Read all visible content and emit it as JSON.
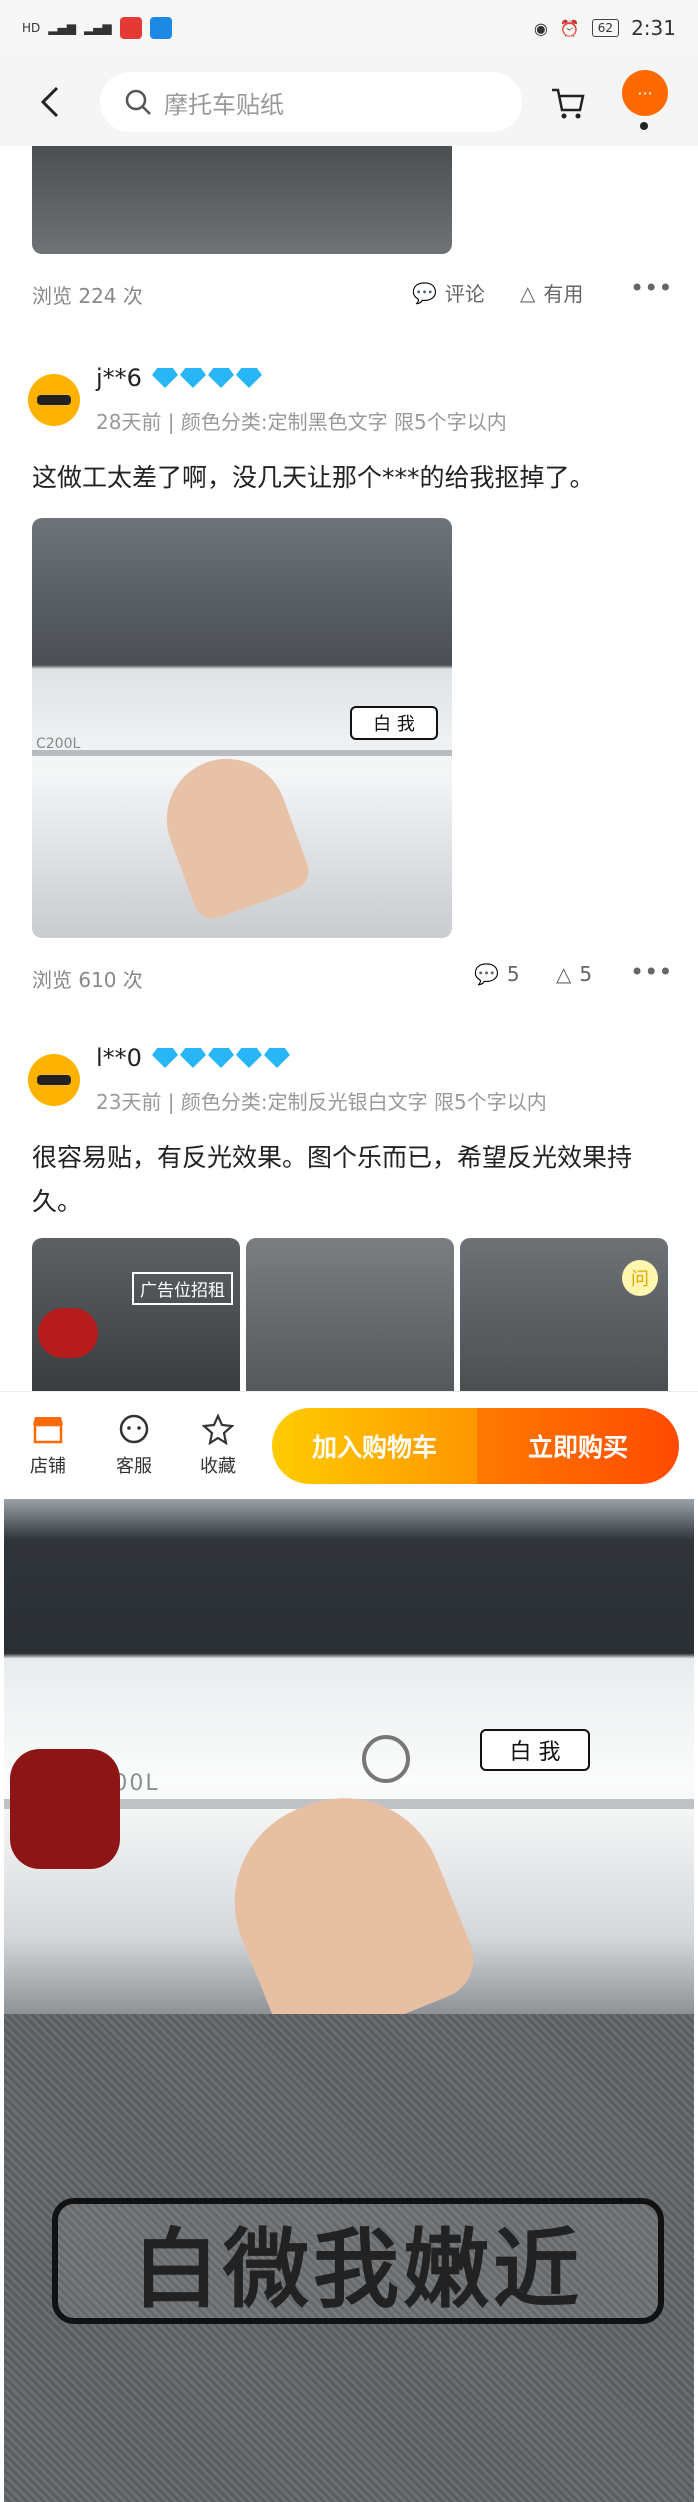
{
  "status": {
    "network_left": "HD",
    "battery": "62",
    "time": "2:31"
  },
  "nav": {
    "search_placeholder": "摩托车贴纸",
    "more_label": "···"
  },
  "first_post": {
    "views": "浏览 224 次",
    "comment_label": "评论",
    "useful_label": "有用"
  },
  "reviews": [
    {
      "user": "j**6",
      "diamonds": 4,
      "meta": "28天前 | 颜色分类:定制黑色文字 限5个字以内",
      "text": "这做工太差了啊，没几天让那个***的给我抠掉了。",
      "views": "浏览 610 次",
      "comments": "5",
      "likes": "5",
      "plate_text": "白 我",
      "car_badge": "C200L"
    },
    {
      "user": "l**0",
      "diamonds": 5,
      "meta": "23天前 | 颜色分类:定制反光银白文字 限5个字以内",
      "text": "很容易贴，有反光效果。图个乐而已，希望反光效果持久。",
      "thumb1_sign": "广告位招租",
      "ask_badge": "问"
    }
  ],
  "bottom": {
    "store": "店铺",
    "service": "客服",
    "favorite": "收藏",
    "add_cart": "加入购物车",
    "buy_now": "立即购买"
  },
  "big_photo": {
    "car_badge": "C200L",
    "plate_text": "白 我"
  },
  "sticker": {
    "text": "白微我嫩近"
  }
}
